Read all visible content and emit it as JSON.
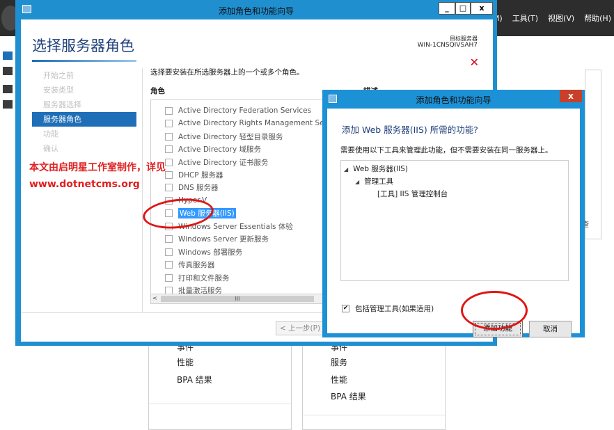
{
  "background": {
    "menu": [
      "理(M)",
      "工具(T)",
      "视图(V)",
      "帮助(H)"
    ],
    "right_panel_text": "查",
    "cards": [
      {
        "items": [
          "事件",
          "性能",
          "BPA 结果"
        ]
      },
      {
        "items": [
          "事件",
          "服务",
          "性能",
          "BPA 结果"
        ]
      }
    ]
  },
  "wizard": {
    "title": "添加角色和功能向导",
    "minimize_label": "_",
    "maximize_label": "□",
    "close_label": "x",
    "heading": "选择服务器角色",
    "target_label": "目标服务器",
    "target_name": "WIN-1CNSQIVSAH7",
    "close_x": "✕",
    "nav": [
      {
        "label": "开始之前",
        "active": false
      },
      {
        "label": "安装类型",
        "active": false
      },
      {
        "label": "服务器选择",
        "active": false
      },
      {
        "label": "服务器角色",
        "active": true
      },
      {
        "label": "功能",
        "active": false
      },
      {
        "label": "确认",
        "active": false
      }
    ],
    "instruction": "选择要安装在所选服务器上的一个或多个角色。",
    "roles_header": "角色",
    "description_header": "描述",
    "roles": [
      "Active Directory Federation Services",
      "Active Directory Rights Management Services",
      "Active Directory 轻型目录服务",
      "Active Directory 域服务",
      "Active Directory 证书服务",
      "DHCP 服务器",
      "DNS 服务器",
      "Hyper-V",
      "Web 服务器(IIS)",
      "Windows Server Essentials 体验",
      "Windows Server 更新服务",
      "Windows 部署服务",
      "传真服务器",
      "打印和文件服务",
      "批量激活服务"
    ],
    "scroll_label": "III",
    "scroll_left": "<",
    "prev_button": "< 上一步(P)"
  },
  "watermark": {
    "line1": "本文由启明星工作室制作，详见",
    "line2": "www.dotnetcms.org"
  },
  "dialog": {
    "title": "添加角色和功能向导",
    "close_label": "x",
    "question": "添加 Web 服务器(IIS) 所需的功能?",
    "explain": "需要使用以下工具来管理此功能，但不需要安装在同一服务器上。",
    "tree": [
      {
        "label": "Web 服务器(IIS)",
        "arrow": "◢"
      },
      {
        "label": "管理工具",
        "arrow": "◢"
      },
      {
        "label": "[工具] IIS 管理控制台",
        "arrow": ""
      }
    ],
    "include_label": "包括管理工具(如果适用)",
    "include_checked": "✔",
    "add_button": "添加功能",
    "cancel_button": "取消"
  }
}
